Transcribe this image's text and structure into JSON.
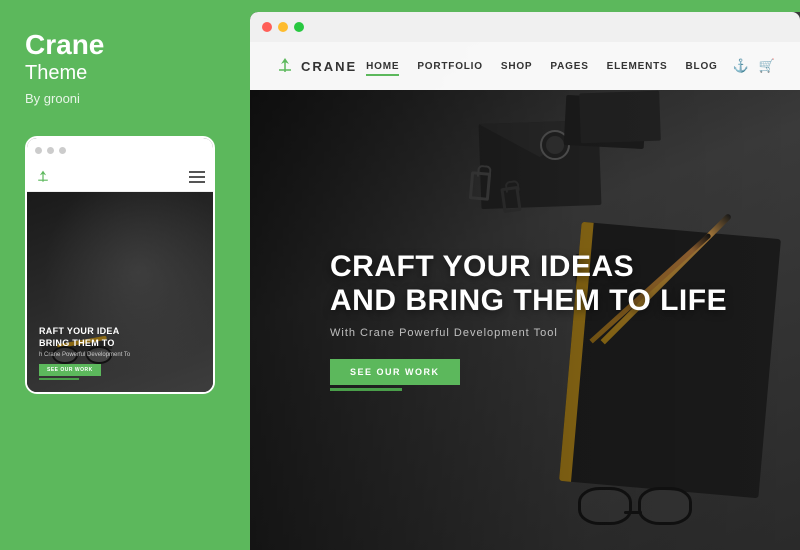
{
  "left": {
    "title": "Crane",
    "subtitle": "Theme",
    "author": "By grooni"
  },
  "mobile": {
    "hero_title_line1": "RAFT YOUR IDEA",
    "hero_title_line2": "BRING THEM TO",
    "hero_sub": "h Crane Powerful Development To",
    "cta": "SEE OUR WORK"
  },
  "desktop": {
    "logo_text": "CRANE",
    "nav": {
      "links": [
        "HOME",
        "PORTFOLIO",
        "SHOP",
        "PAGES",
        "ELEMENTS",
        "BLOG"
      ]
    },
    "hero": {
      "title_line1": "CRAFT YOUR IDEAS",
      "title_line2": "AND BRING THEM TO LIFE",
      "subtitle": "With Crane Powerful Development Tool",
      "cta": "SEE OUR WORK"
    }
  }
}
